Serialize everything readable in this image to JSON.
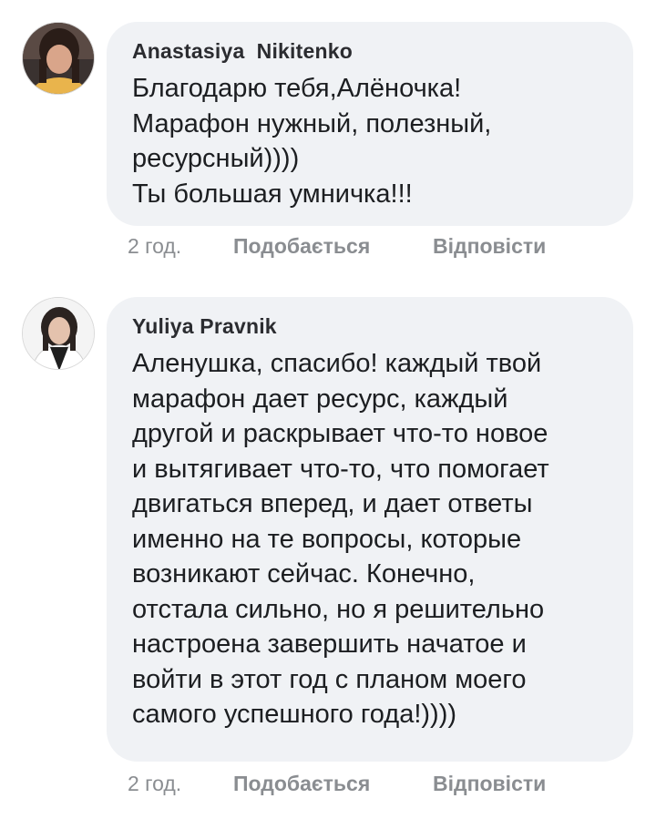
{
  "comments": [
    {
      "author": "Anastasiya  Nikitenko",
      "avatar_icon": "user-photo-woman-dark-hair",
      "lines": [
        "Благодарю тебя,Алёночка!",
        "Марафон нужный, полезный,",
        "ресурсный))))",
        "Ты большая умничка!!!"
      ],
      "time": "2 год.",
      "like_label": "Подобається",
      "reply_label": "Відповісти"
    },
    {
      "author": "Yuliya Pravnik",
      "avatar_icon": "user-photo-woman-light-background",
      "lines": [
        "Аленушка, спасибо! каждый твой",
        "марафон дает ресурс, каждый",
        "другой и раскрывает что-то новое",
        "и вытягивает что-то, что помогает",
        "двигаться вперед, и дает ответы",
        "именно на те вопросы, которые",
        "возникают сейчас. Конечно,",
        "отстала сильно, но я решительно",
        "настроена завершить начатое и",
        "войти в этот год с планом моего",
        "самого успешного года!))))"
      ],
      "time": "2 год.",
      "like_label": "Подобається",
      "reply_label": "Відповісти"
    }
  ],
  "colors": {
    "bubble_bg": "#f0f2f5",
    "text": "#1c1e21",
    "meta": "#8a8d91"
  }
}
